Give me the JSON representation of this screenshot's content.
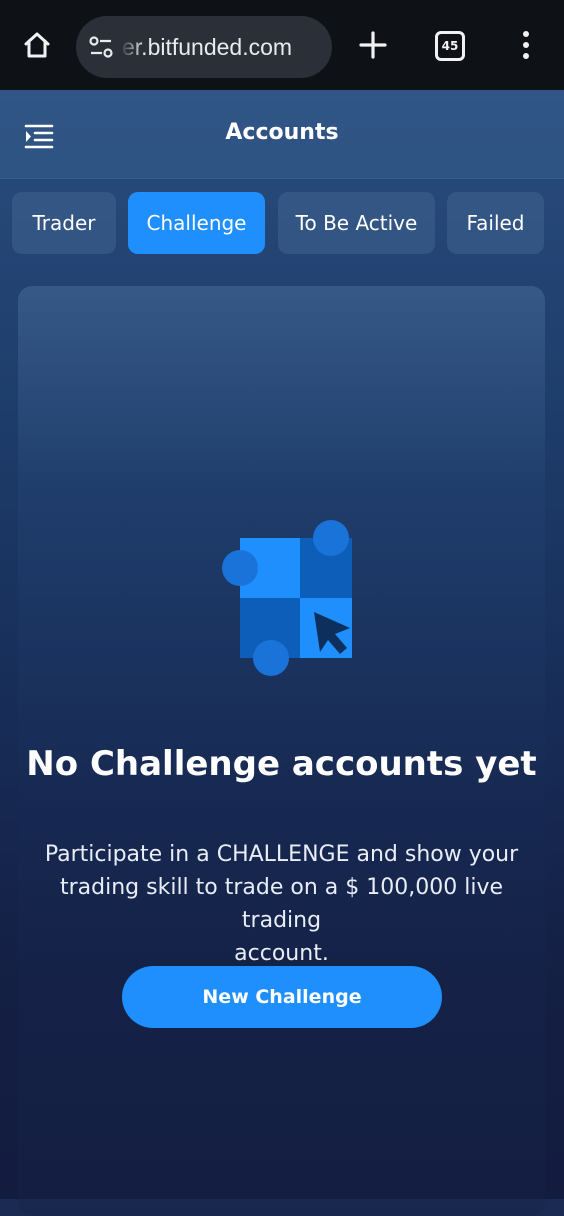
{
  "browser": {
    "url": "er.bitfunded.com",
    "tab_count": "45",
    "icons": {
      "home": "home-icon",
      "site_settings": "tune-icon",
      "new_tab": "plus-icon",
      "overflow_menu": "more-vert-icon"
    }
  },
  "header": {
    "title": "Accounts",
    "drawer_icon": "menu-indent-icon"
  },
  "tabs": [
    {
      "label": "Trader",
      "active": false
    },
    {
      "label": "Challenge",
      "active": true
    },
    {
      "label": "To Be Active",
      "active": false
    },
    {
      "label": "Failed",
      "active": false
    }
  ],
  "empty_state": {
    "illustration_icon": "checkerboard-cursor-icon",
    "title": "No Challenge accounts yet",
    "description_lines": [
      "Participate in a CHALLENGE and show your",
      "trading skill to trade on a $ 100,000 live trading",
      "account."
    ],
    "button_label": "New Challenge"
  },
  "colors": {
    "accent": "#1e8ffc",
    "browser_bar": "#0e1116",
    "url_pill": "#2b2f38"
  }
}
